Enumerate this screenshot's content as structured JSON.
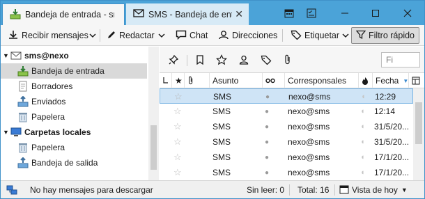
{
  "tabs": [
    {
      "label": "Bandeja de entrada - sms@nexo",
      "icon": "inbox-download-icon"
    },
    {
      "label": "SMS - Bandeja de entrada",
      "icon": "envelope-icon"
    }
  ],
  "toolbar": {
    "get_messages": "Recibir mensajes",
    "write": "Redactar",
    "chat": "Chat",
    "address_book": "Direcciones",
    "tag": "Etiquetar",
    "quick_filter": "Filtro rápido"
  },
  "folders": {
    "account1": "sms@nexo",
    "inbox": "Bandeja de entrada",
    "drafts": "Borradores",
    "sent": "Enviados",
    "trash": "Papelera",
    "account2": "Carpetas locales",
    "local_trash": "Papelera",
    "outbox": "Bandeja de salida"
  },
  "search": {
    "placeholder": "Fi"
  },
  "columns": {
    "subject": "Asunto",
    "correspondents": "Corresponsales",
    "date": "Fecha"
  },
  "messages": [
    {
      "subject": "SMS",
      "correspondent": "nexo@sms",
      "date": "12:29"
    },
    {
      "subject": "SMS",
      "correspondent": "nexo@sms",
      "date": "12:14"
    },
    {
      "subject": "SMS",
      "correspondent": "nexo@sms",
      "date": "31/5/20..."
    },
    {
      "subject": "SMS",
      "correspondent": "nexo@sms",
      "date": "31/5/20..."
    },
    {
      "subject": "SMS",
      "correspondent": "nexo@sms",
      "date": "17/1/20..."
    },
    {
      "subject": "SMS",
      "correspondent": "nexo@sms",
      "date": "17/1/20..."
    }
  ],
  "status": {
    "message": "No hay mensajes para descargar",
    "unread": "Sin leer: 0",
    "total": "Total: 16",
    "today": "Vista de hoy"
  },
  "colors": {
    "titlebar": "#4ba3d8",
    "selection": "#cfe4f6"
  }
}
